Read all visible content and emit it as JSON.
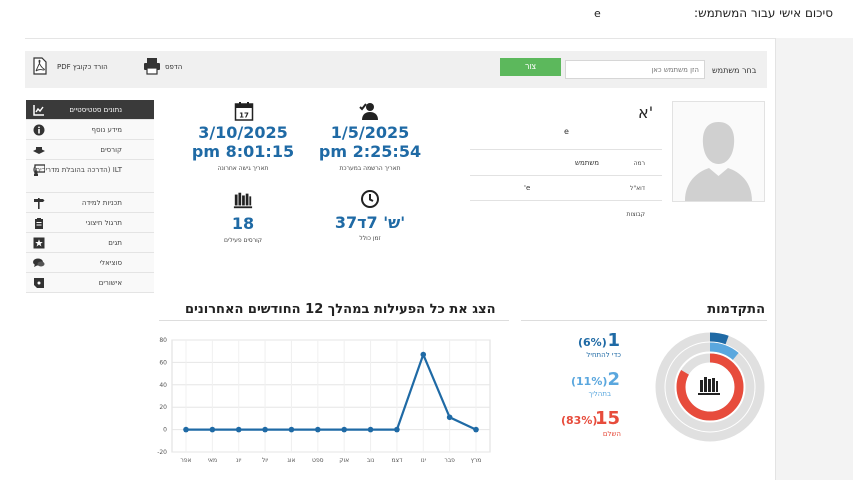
{
  "header": {
    "title": "סיכום אישי עבור המשתמש:",
    "user": "e"
  },
  "toolbar": {
    "select_user_label": "בחר משתמש",
    "search_placeholder": "הזן משתמש כאן",
    "view_label": "צור",
    "print_label": "הדפס",
    "pdf_label": "הורד כקובץ PDF"
  },
  "sidebar": {
    "items": [
      {
        "label": "נתונים סטטיסטיים",
        "icon": "chart-icon"
      },
      {
        "label": "מידע נוסף",
        "icon": "info-icon"
      },
      {
        "label": "קורסים",
        "icon": "courses-icon"
      },
      {
        "label": "ILT (הדרכה בהובלת מדריכים)",
        "icon": "ilt-icon"
      },
      {
        "label": "תכניות למידה",
        "icon": "learning-path-icon"
      },
      {
        "label": "תרגול חיצוני",
        "icon": "clipboard-icon"
      },
      {
        "label": "תגים",
        "icon": "badge-star-icon"
      },
      {
        "label": "סוציאלי",
        "icon": "chat-icon"
      },
      {
        "label": "אישורים",
        "icon": "certificate-icon"
      }
    ]
  },
  "profile": {
    "display_name": "א'",
    "username": "e",
    "role_key": "רמה",
    "role_value": "משתמש",
    "email_key": "דוא\"ל",
    "email_value": "e'",
    "groups_key": "קבוצות",
    "groups_value": ""
  },
  "stats": {
    "registration_date": "1/5/2025",
    "registration_time": "pm 2:25:54",
    "registration_label": "תאריך הרשמה במערכת",
    "last_access_date": "3/10/2025",
    "last_access_time": "pm 8:01:15",
    "last_access_label": "תאריך גישה אחרונה",
    "total_time": "37ש' 7ד'",
    "total_time_label": "זמן כולל",
    "active_courses": "18",
    "active_courses_label": "קורסים פעילים"
  },
  "progress": {
    "title": "התקדמות",
    "not_started_count": "1",
    "not_started_pct": "(6%)",
    "not_started_label": "כדי להתחיל",
    "in_progress_count": "2",
    "in_progress_pct": "(11%)",
    "in_progress_label": "בתהליך",
    "completed_count": "15",
    "completed_pct": "(83%)",
    "completed_label": "השלם",
    "colors": {
      "not_started": "#1f6aa5",
      "in_progress": "#5aa7de",
      "completed": "#e74c3c",
      "track": "#e0e0e0"
    }
  },
  "activity": {
    "title": "הצג את כל הפעילות במהלך 12 החודשים האחרונים"
  },
  "chart_data": {
    "type": "line",
    "categories": [
      "אפר",
      "מאי",
      "יונ",
      "יול",
      "אוג",
      "ספט",
      "אוק",
      "נוב",
      "דצמ",
      "ינו",
      "פבר",
      "מרץ"
    ],
    "series": [
      {
        "values": [
          0,
          0,
          0,
          0,
          0,
          0,
          0,
          0,
          0,
          67,
          11,
          0
        ]
      }
    ],
    "ylim": [
      -20,
      80
    ],
    "yticks": [
      -20,
      0,
      20,
      40,
      60,
      80
    ],
    "grid": true,
    "color": "#1f6aa5"
  }
}
